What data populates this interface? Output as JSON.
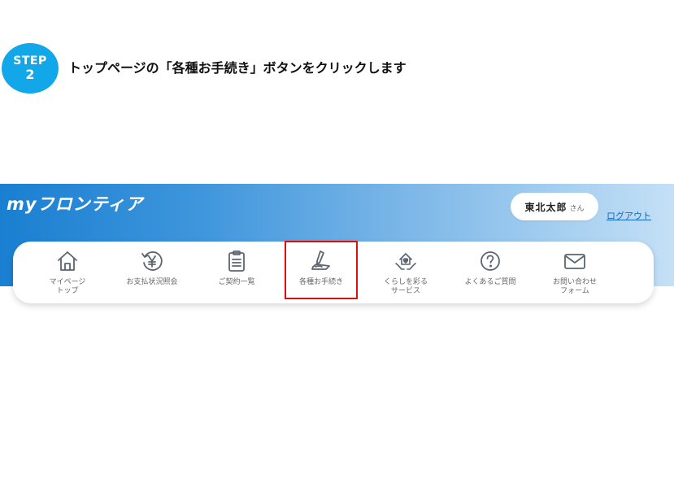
{
  "step": {
    "label": "STEP",
    "number": "2",
    "instruction": "トップページの「各種お手続き」ボタンをクリックします",
    "badge_color": "#12a7e9"
  },
  "app": {
    "logo": "myフロンティア",
    "user": {
      "name": "東北太郎",
      "honorific": "さん"
    },
    "logout_label": "ログアウト",
    "nav": [
      {
        "label_line1": "マイページ",
        "label_line2": "トップ",
        "icon": "home-icon"
      },
      {
        "label_line1": "お支払状況照会",
        "label_line2": "",
        "icon": "yen-history-icon"
      },
      {
        "label_line1": "ご契約一覧",
        "label_line2": "",
        "icon": "clipboard-icon"
      },
      {
        "label_line1": "各種お手続き",
        "label_line2": "",
        "icon": "pen-sign-icon",
        "highlighted": true
      },
      {
        "label_line1": "くらしを彩る",
        "label_line2": "サービス",
        "icon": "house-heart-icon"
      },
      {
        "label_line1": "よくあるご質問",
        "label_line2": "",
        "icon": "question-icon"
      },
      {
        "label_line1": "お問い合わせ",
        "label_line2": "フォーム",
        "icon": "mail-icon"
      }
    ]
  },
  "colors": {
    "highlight_border": "#e00d0d",
    "link": "#1565c0",
    "icon_stroke": "#5a6570"
  }
}
